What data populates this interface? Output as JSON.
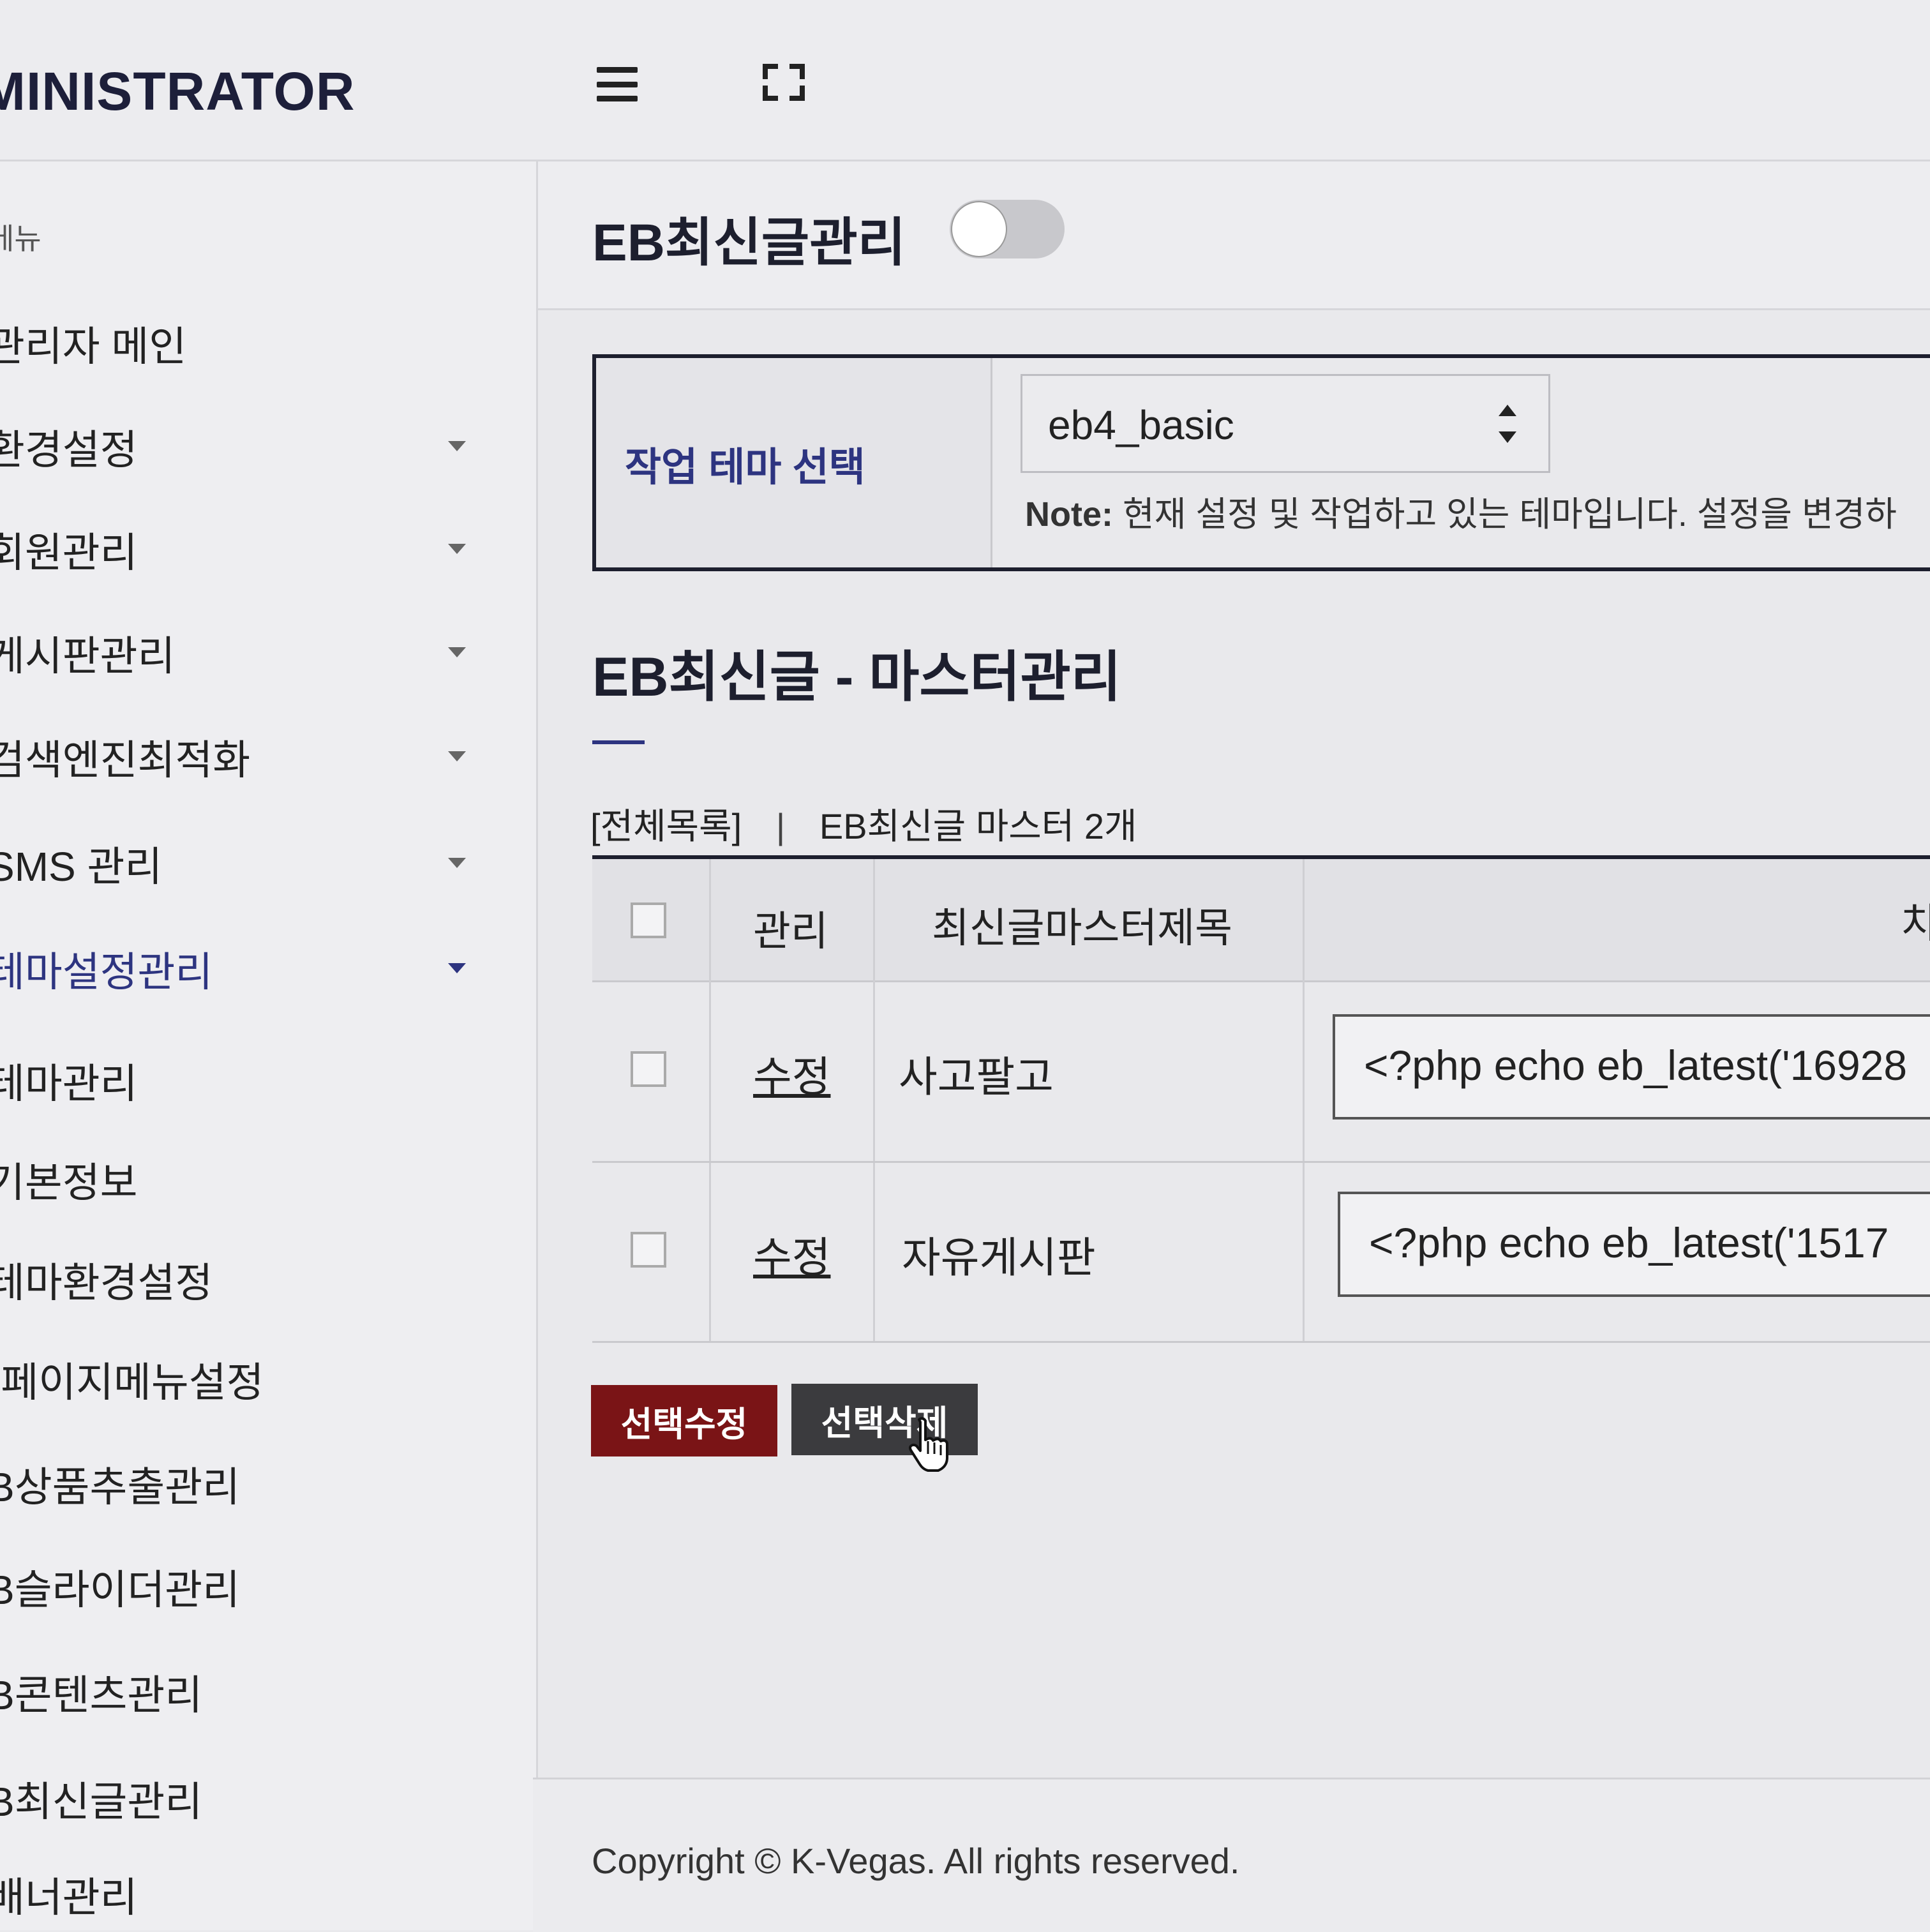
{
  "header": {
    "brand": "MINISTRATOR",
    "menu_toggle_icon": "hamburger-icon",
    "fullscreen_icon": "fullscreen-icon"
  },
  "sidebar": {
    "heading": "메뉴",
    "items": [
      {
        "label": "관리자 메인",
        "has_caret": false
      },
      {
        "label": "환경설정",
        "has_caret": true
      },
      {
        "label": "회원관리",
        "has_caret": true
      },
      {
        "label": "게시판관리",
        "has_caret": true
      },
      {
        "label": "검색엔진최적화",
        "has_caret": true
      },
      {
        "label": "SMS 관리",
        "has_caret": true
      },
      {
        "label": "테마설정관리",
        "has_caret": true,
        "active": true
      },
      {
        "label": "테마관리"
      },
      {
        "label": "기본정보"
      },
      {
        "label": "테마환경설정"
      },
      {
        "label": "-페이지메뉴설정"
      },
      {
        "label": "B상품추출관리"
      },
      {
        "label": "B슬라이더관리"
      },
      {
        "label": "B콘텐츠관리"
      },
      {
        "label": "B최신글관리"
      },
      {
        "label": "배너관리"
      }
    ]
  },
  "content": {
    "title": "EB최신글관리",
    "toggle_on": false,
    "theme": {
      "label": "작업 테마 선택",
      "selected": "eb4_basic",
      "note_prefix": "Note:",
      "note_text": "현재 설정 및 작업하고 있는 테마입니다. 설정을 변경하"
    },
    "section_title": "EB최신글 - 마스터관리",
    "summary": {
      "all_list": "[전체목록]",
      "separator": "|",
      "count_text": "EB최신글 마스터 2개"
    },
    "table": {
      "headers": [
        "관리",
        "최신글마스터제목",
        "치"
      ],
      "rows": [
        {
          "action": "수정",
          "title": "사고팔고",
          "code": "<?php echo eb_latest('16928"
        },
        {
          "action": "수정",
          "title": "자유게시판",
          "code": "<?php echo eb_latest('1517"
        }
      ]
    },
    "buttons": {
      "edit_selected": "선택수정",
      "delete_selected": "선택삭제"
    },
    "colors": {
      "accent": "#2d3480",
      "edit_button": "#7a1416",
      "delete_button": "#3b3b3e"
    }
  },
  "footer": {
    "copyright": "Copyright © K-Vegas. All rights reserved."
  }
}
